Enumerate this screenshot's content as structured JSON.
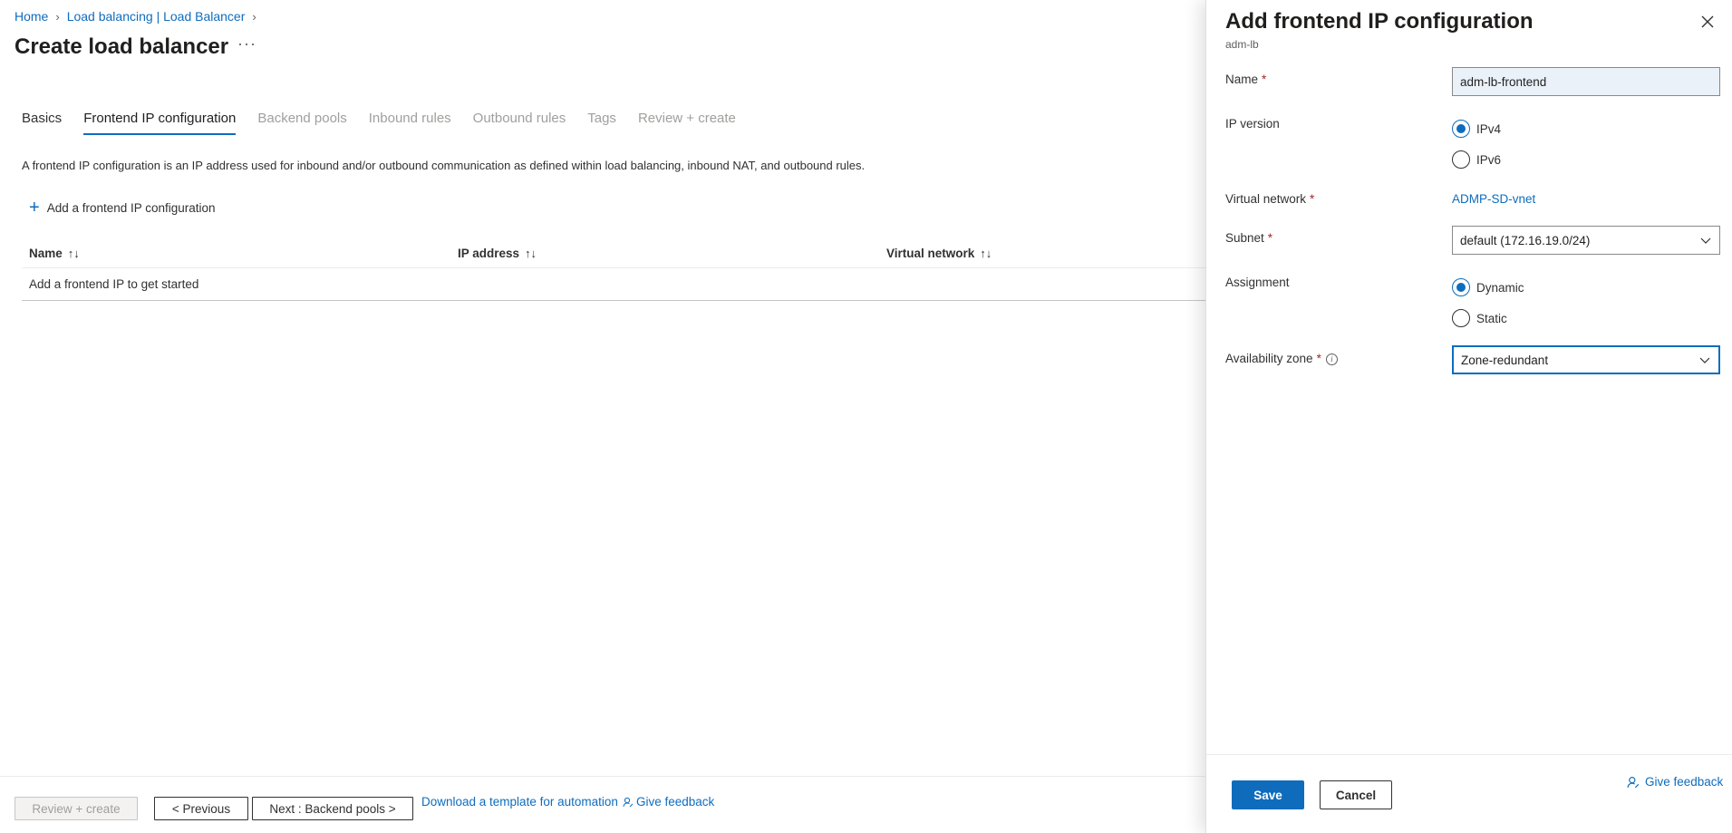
{
  "breadcrumb": {
    "items": [
      "Home",
      "Load balancing | Load Balancer"
    ]
  },
  "page": {
    "title": "Create load balancer",
    "more": "···"
  },
  "tabs": [
    "Basics",
    "Frontend IP configuration",
    "Backend pools",
    "Inbound rules",
    "Outbound rules",
    "Tags",
    "Review + create"
  ],
  "description": "A frontend IP configuration is an IP address used for inbound and/or outbound communication as defined within load balancing, inbound NAT, and outbound rules.",
  "add_action": {
    "label": "Add a frontend IP configuration",
    "icon": "plus-icon"
  },
  "table": {
    "columns": [
      "Name",
      "IP address",
      "Virtual network"
    ],
    "sort_glyph": "↑↓",
    "empty_text": "Add a frontend IP to get started"
  },
  "footer": {
    "review_create": "Review + create",
    "previous": "< Previous",
    "next": "Next : Backend pools >",
    "download_template": "Download a template for automation",
    "give_feedback": "Give feedback"
  },
  "panel": {
    "title": "Add frontend IP configuration",
    "subtitle": "adm-lb",
    "fields": {
      "name_label": "Name",
      "name_value": "adm-lb-frontend",
      "ip_version_label": "IP version",
      "ip_version_options": [
        "IPv4",
        "IPv6"
      ],
      "ip_version_selected": "IPv4",
      "vnet_label": "Virtual network",
      "vnet_value": "ADMP-SD-vnet",
      "subnet_label": "Subnet",
      "subnet_value": "default (172.16.19.0/24)",
      "assignment_label": "Assignment",
      "assignment_options": [
        "Dynamic",
        "Static"
      ],
      "assignment_selected": "Dynamic",
      "zone_label": "Availability zone",
      "zone_value": "Zone-redundant"
    },
    "required_mark": "*",
    "save": "Save",
    "cancel": "Cancel",
    "give_feedback": "Give feedback"
  },
  "colors": {
    "accent": "#0f6cbd",
    "required": "#a4262c"
  }
}
